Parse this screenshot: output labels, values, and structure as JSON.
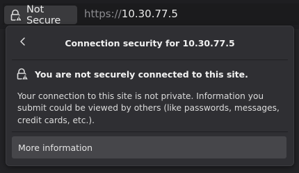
{
  "urlbar": {
    "identity_icon": "warning-lock-icon",
    "identity_label": "Not Secure",
    "url_scheme": "https://",
    "url_host": "10.30.77.5"
  },
  "panel": {
    "back_icon": "chevron-left-icon",
    "title": "Connection security for 10.30.77.5",
    "warning_icon": "warning-lock-icon",
    "warning_title": "You are not securely connected to this site.",
    "description": "Your connection to this site is not private. Information you submit could be viewed by others (like passwords, messages, credit cards, etc.).",
    "more_info_label": "More information"
  }
}
